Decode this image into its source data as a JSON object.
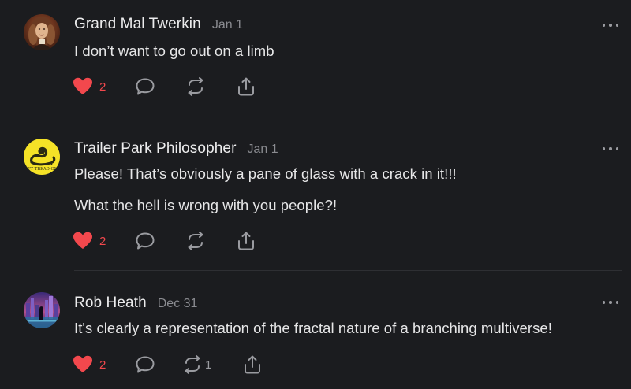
{
  "colors": {
    "background": "#1b1c1f",
    "like_red": "#f2484d",
    "icon_gray": "#9a9ba0",
    "date_gray": "#8a8b90",
    "text": "#e6e6e7"
  },
  "posts": [
    {
      "author": "Grand Mal Twerkin",
      "date": "Jan 1",
      "avatar": "portrait-avatar",
      "paragraphs": [
        "I don’t want to go out on a limb"
      ],
      "likes": "2",
      "liked": true,
      "restacks": "",
      "icons": [
        "heart-icon",
        "comment-icon",
        "restack-icon",
        "share-icon",
        "more-icon"
      ]
    },
    {
      "author": "Trailer Park Philosopher",
      "date": "Jan 1",
      "avatar": "gadsden-flag-avatar",
      "avatar_text": "N'T TREAD ON",
      "paragraphs": [
        "Please! That’s obviously a pane of glass with a crack in it!!!",
        "What the hell is wrong with you people?!"
      ],
      "likes": "2",
      "liked": true,
      "restacks": "",
      "icons": [
        "heart-icon",
        "comment-icon",
        "restack-icon",
        "share-icon",
        "more-icon"
      ]
    },
    {
      "author": "Rob Heath",
      "date": "Dec 31",
      "avatar": "cityscape-avatar",
      "paragraphs": [
        "It's clearly a representation of the fractal nature of a branching multiverse!"
      ],
      "likes": "2",
      "liked": true,
      "restacks": "1",
      "icons": [
        "heart-icon",
        "comment-icon",
        "restack-icon",
        "share-icon",
        "more-icon"
      ]
    }
  ]
}
